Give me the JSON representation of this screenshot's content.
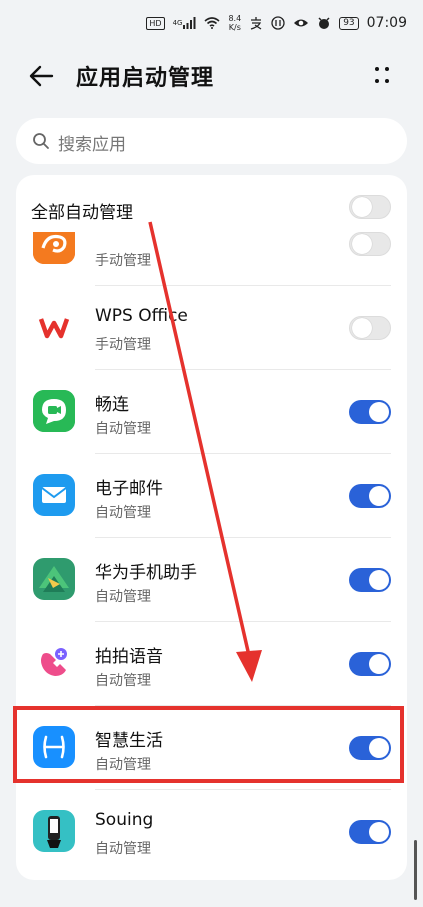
{
  "status_bar": {
    "hd": "HD",
    "net": "4G",
    "speed_value": "8.4",
    "speed_unit": "K/s",
    "battery": "93",
    "time": "07:09"
  },
  "header": {
    "title": "应用启动管理",
    "back_icon": "back-arrow-icon",
    "more_icon": "more-dots-icon"
  },
  "search": {
    "placeholder": "搜索应用"
  },
  "all_manage": {
    "label": "全部自动管理",
    "enabled": false
  },
  "apps": [
    {
      "name": "",
      "status": "手动管理",
      "enabled": false,
      "icon": "uc-browser-icon"
    },
    {
      "name": "WPS Office",
      "status": "手动管理",
      "enabled": false,
      "icon": "wps-office-icon"
    },
    {
      "name": "畅连",
      "status": "自动管理",
      "enabled": true,
      "icon": "changlian-icon"
    },
    {
      "name": "电子邮件",
      "status": "自动管理",
      "enabled": true,
      "icon": "email-icon"
    },
    {
      "name": "华为手机助手",
      "status": "自动管理",
      "enabled": true,
      "icon": "huawei-assistant-icon"
    },
    {
      "name": "拍拍语音",
      "status": "自动管理",
      "enabled": true,
      "icon": "paipai-voice-icon"
    },
    {
      "name": "智慧生活",
      "status": "自动管理",
      "enabled": true,
      "icon": "smart-life-icon"
    },
    {
      "name": "Souing",
      "status": "自动管理",
      "enabled": true,
      "icon": "souing-icon"
    }
  ],
  "colors": {
    "accent": "#2a62d8",
    "highlight": "#e5322d"
  }
}
